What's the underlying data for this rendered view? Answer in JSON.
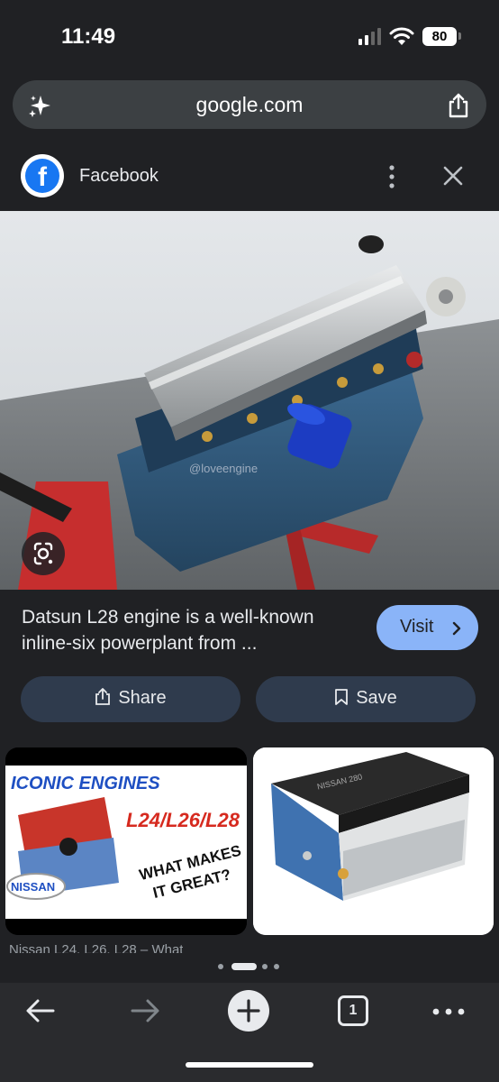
{
  "status": {
    "time": "11:49",
    "battery": "80"
  },
  "url_bar": {
    "url": "google.com",
    "icons": [
      "sparkle-icon",
      "share-icon"
    ]
  },
  "source": {
    "name": "Facebook",
    "logo": "f",
    "icons": [
      "facebook-logo",
      "more-vert-icon",
      "close-icon"
    ]
  },
  "result": {
    "watermark": "@loveengine",
    "caption": "Datsun L28 engine is a well-known inline-six powerplant from ...",
    "visit_label": "Visit",
    "share_label": "Share",
    "save_label": "Save"
  },
  "related": {
    "left_title_line1": "ICONIC ENGINES",
    "left_title_line2": "L24/L26/L28",
    "left_subtitle_line1": "WHAT MAKES",
    "left_subtitle_line2": "IT GREAT?",
    "left_brand": "NISSAN",
    "right_brand": "NISSAN 280",
    "left_caption": "Nissan L24, L26, L28 – What"
  },
  "bottom_nav": {
    "tab_count": "1",
    "icons": [
      "back-icon",
      "forward-icon",
      "new-tab-icon",
      "tabs-icon",
      "more-horiz-icon"
    ]
  },
  "colors": {
    "background": "#202124",
    "accent": "#8ab4f8",
    "button_bg": "#2f3b4d",
    "url_bar": "#3c4043"
  }
}
